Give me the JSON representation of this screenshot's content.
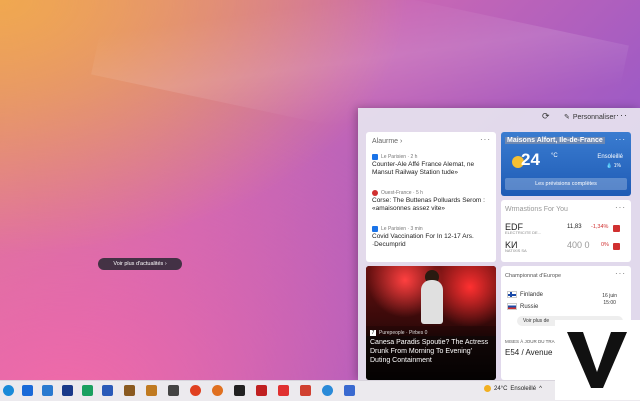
{
  "header": {
    "personalize_label": "Personnaliser"
  },
  "top_stories": {
    "title": "Alaurme ›",
    "items": [
      {
        "source": "Le Parisien · 2 h",
        "headline": "Counter-Ale Affé France Alemat, ne Mansut Railway Station tude»",
        "color": "#1a73e8"
      },
      {
        "source": "Ouest-France · 5 h",
        "headline": "Corse: The Buttenas Polluards Serom : «amaisonnes assez vite»",
        "color": "#d03030"
      },
      {
        "source": "Le Parisien · 3 min",
        "headline": "Covid Vaccination For In 12-17 Ars. ·Decumprid",
        "color": "#1a73e8"
      }
    ]
  },
  "weather": {
    "location": "Maisons Alfort, Ile-de-France",
    "temperature": "24",
    "unit": "°C",
    "condition": "Ensoleillé",
    "rain": "💧 1%",
    "button_label": "Les prévisions complètes"
  },
  "stocks": {
    "title": "Wrmastions For You",
    "rows": [
      {
        "symbol": "EDF",
        "name": "ELECTRICITE DE...",
        "price": "11,83",
        "change": "-1,34%"
      },
      {
        "symbol": "KИ",
        "name": "NATIXIS SA",
        "price": "400 0",
        "change": "0%"
      }
    ]
  },
  "photo_news": {
    "source": "Purepeople · Pirbes 0",
    "source_icon": "7",
    "headline": "Canesa Paradis Spoutie? The Actress Drunk From Morning To Evening' Duting Containment"
  },
  "sports": {
    "title": "Championnat d'Europe",
    "team1": "Finlande",
    "team2": "Russie",
    "date_line1": "16 juin",
    "date_line2": "15:00",
    "more_label": "Voir plus de",
    "traffic_label": "MISES À JOUR DU TRAFIC",
    "traffic_title": "E54 / Avenue D..."
  },
  "more_news_label": "Voir plus d'actualités ›",
  "taskbar": {
    "weather_temp": "24°C",
    "weather_condition": "Ensoleillé"
  }
}
